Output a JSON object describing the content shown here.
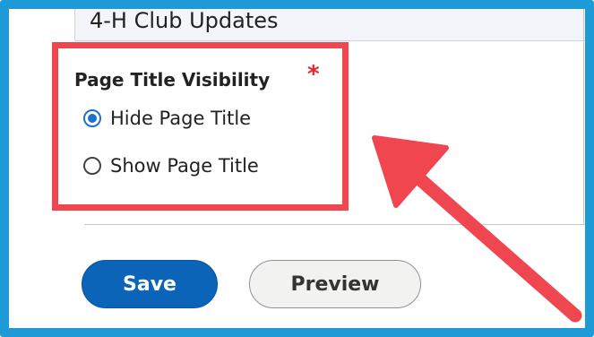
{
  "title_field": {
    "value": "4-H Club Updates"
  },
  "page_title_visibility": {
    "legend": "Page Title Visibility",
    "required_marker": "*",
    "options": [
      {
        "label": "Hide Page Title",
        "checked": true
      },
      {
        "label": "Show Page Title",
        "checked": false
      }
    ]
  },
  "actions": {
    "save_label": "Save",
    "preview_label": "Preview"
  },
  "colors": {
    "frame": "#1e9bd7",
    "highlight": "#ef4650",
    "primary": "#0b64b8",
    "required": "#e2242b"
  }
}
